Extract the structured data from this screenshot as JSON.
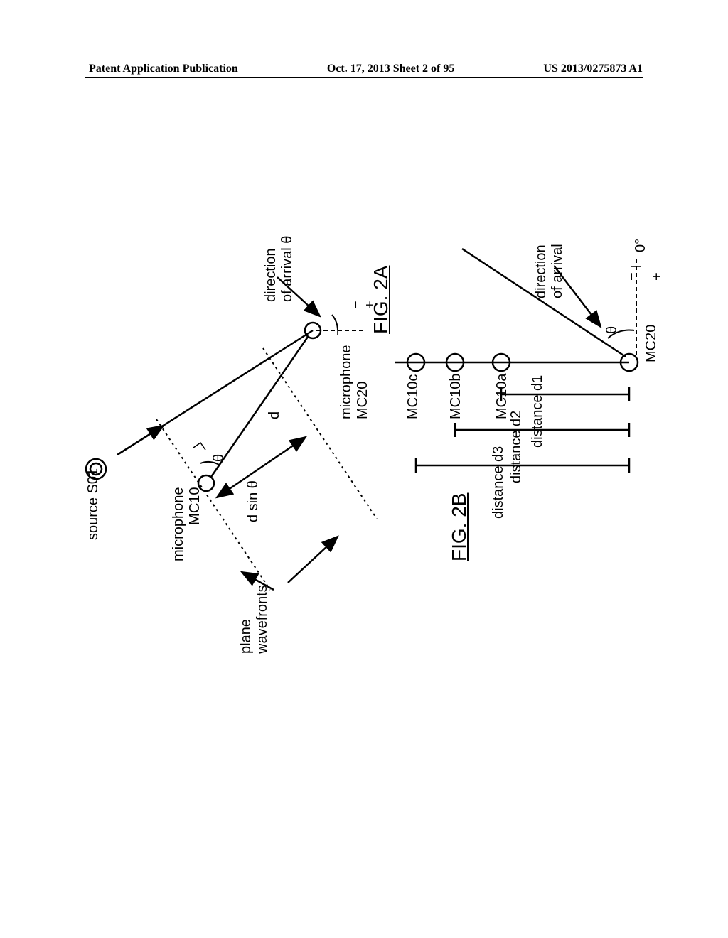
{
  "header": {
    "left": "Patent Application Publication",
    "center": "Oct. 17, 2013  Sheet 2 of 95",
    "right": "US 2013/0275873 A1"
  },
  "figA": {
    "title": "FIG. 2A",
    "source_label": "source S01",
    "mic10_label": "microphone\nMC10",
    "mic20_label": "microphone\nMC20",
    "direction_label": "direction\nof arrival θ",
    "dsin_label": "d sin θ",
    "d_label": "d",
    "theta_label": "θ",
    "plane_label": "plane\nwavefronts",
    "plus": "+",
    "minus": "−"
  },
  "figB": {
    "title": "FIG. 2B",
    "mc10a": "MC10a",
    "mc10b": "MC10b",
    "mc10c": "MC10c",
    "mc20": "MC20",
    "zero_deg": "0°",
    "direction_label": "direction\nof arrival",
    "theta_label": "θ",
    "d1_label": "distance d1",
    "d2_label": "distance d2",
    "d3_label": "distance d3",
    "plus": "+",
    "minus": "−"
  }
}
